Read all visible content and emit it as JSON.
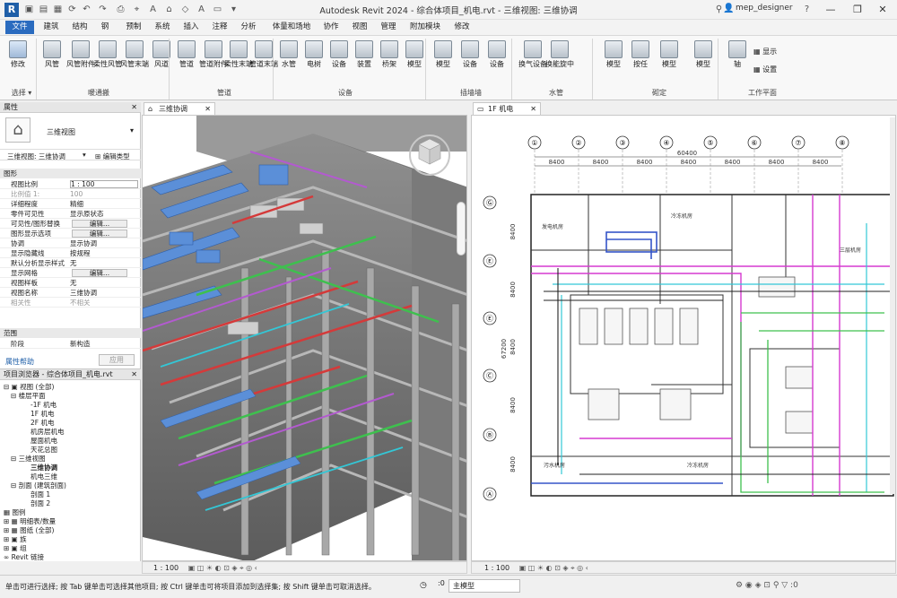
{
  "app": {
    "title": "Autodesk Revit 2024 - 综合体项目_机电.rvt - 三维视图: 三维协调",
    "user": "mep_designer",
    "logo": "R"
  },
  "tabs": [
    "文件",
    "建筑",
    "结构",
    "钢",
    "预制",
    "系统",
    "插入",
    "注释",
    "分析",
    "体量和场地",
    "协作",
    "视图",
    "管理",
    "附加模块",
    "修改"
  ],
  "ribbon": {
    "buttons": [
      {
        "label": "修改"
      },
      {
        "label": "风管"
      },
      {
        "label": "风管附件"
      },
      {
        "label": "柔性风管"
      },
      {
        "label": "风管末端"
      },
      {
        "label": "风道"
      },
      {
        "label": "管道"
      },
      {
        "label": "管道附件"
      },
      {
        "label": "柔性末端"
      },
      {
        "label": "管道末端"
      },
      {
        "label": "水管"
      },
      {
        "label": "电树"
      },
      {
        "label": "设备"
      },
      {
        "label": "装置"
      },
      {
        "label": "桥架"
      },
      {
        "label": "模型"
      },
      {
        "label": "模型"
      },
      {
        "label": "设备"
      },
      {
        "label": "设备"
      },
      {
        "label": "换气设备"
      },
      {
        "label": "换能旋中"
      },
      {
        "label": "模型"
      },
      {
        "label": "按任"
      },
      {
        "label": "模型"
      },
      {
        "label": "模型"
      },
      {
        "label": "轴"
      },
      {
        "label": "显示"
      },
      {
        "label": "设置"
      }
    ],
    "panels": [
      "选择 ▾",
      "暖通搬",
      "管道",
      "设备",
      "插墙墙",
      "水管",
      "砌定",
      "工作平面"
    ]
  },
  "properties": {
    "header": "属性",
    "type_name": "三维视图",
    "view_selector": "三维视图: 三维协调",
    "edit_type": "编辑类型",
    "section_graphics": "图形",
    "rows": [
      {
        "k": "视图比例",
        "v": "1 : 100"
      },
      {
        "k": "比例值 1:",
        "v": "100"
      },
      {
        "k": "详细程度",
        "v": "精细"
      },
      {
        "k": "零件可见性",
        "v": "显示原状态"
      },
      {
        "k": "可见性/图形替换",
        "v": "编辑..."
      },
      {
        "k": "图形显示选项",
        "v": "编辑..."
      },
      {
        "k": "协调",
        "v": "显示协调"
      },
      {
        "k": "显示隐藏线",
        "v": "按规程"
      },
      {
        "k": "默认分析显示样式",
        "v": "无"
      },
      {
        "k": "显示网格",
        "v": "编辑..."
      },
      {
        "k": "视图样板",
        "v": "无"
      },
      {
        "k": "视图名称",
        "v": "三维协调"
      },
      {
        "k": "相关性",
        "v": "不相关"
      }
    ],
    "section_extent": "范围",
    "phase_k": "阶段",
    "phase_v": "新构造",
    "help": "属性帮助",
    "apply": "应用"
  },
  "browser": {
    "header": "项目浏览器 - 综合体项目_机电.rvt",
    "items": [
      "视图 (全部)",
      "楼层平面",
      "-1F 机电",
      "1F 机电",
      "2F 机电",
      "机房层机电",
      "屋面机电",
      "天花总图",
      "三维视图",
      "三维协调",
      "机电三维",
      "剖面 (建筑剖面)",
      "剖面 1",
      "剖面 2",
      "图例",
      "明细表/数量",
      "图纸 (全部)",
      "族",
      "组",
      "Revit 链接"
    ]
  },
  "views": {
    "left_tab": "三维协调",
    "right_tab": "1F 机电",
    "left_scale": "1 : 100",
    "right_scale": "1 : 100"
  },
  "plan": {
    "grid_cols": [
      "①",
      "②",
      "③",
      "④",
      "⑤",
      "⑥",
      "⑦",
      "⑧"
    ],
    "grid_rows": [
      "Ⓖ",
      "Ⓔ",
      "Ⓔ",
      "Ⓒ",
      "Ⓑ",
      "Ⓐ"
    ],
    "dim_total": "60400",
    "dim_bays": [
      "8400",
      "8400",
      "8400",
      "8400",
      "8400",
      "8400",
      "8400"
    ],
    "dim_total_v": "67200",
    "dim_v": [
      "8400",
      "8400",
      "8400",
      "8400",
      "8400"
    ],
    "room_labels": [
      "发电机房",
      "冷冻机房",
      "三层机房",
      "污水机房",
      "冷冻机房"
    ]
  },
  "status": {
    "text": "单击可进行选择; 按 Tab 键单击可选择其他项目; 按 Ctrl 键单击可将项目添加到选择集; 按 Shift 键单击可取消选择。",
    "model": "主模型",
    "zero": ":0"
  },
  "colors": {
    "accent": "#2a6bbf",
    "duct": "#5b8fd8",
    "pipe_red": "#d43a3a",
    "pipe_green": "#3ec04e",
    "pipe_magenta": "#d63ad0",
    "pipe_cyan": "#33c7d6"
  }
}
